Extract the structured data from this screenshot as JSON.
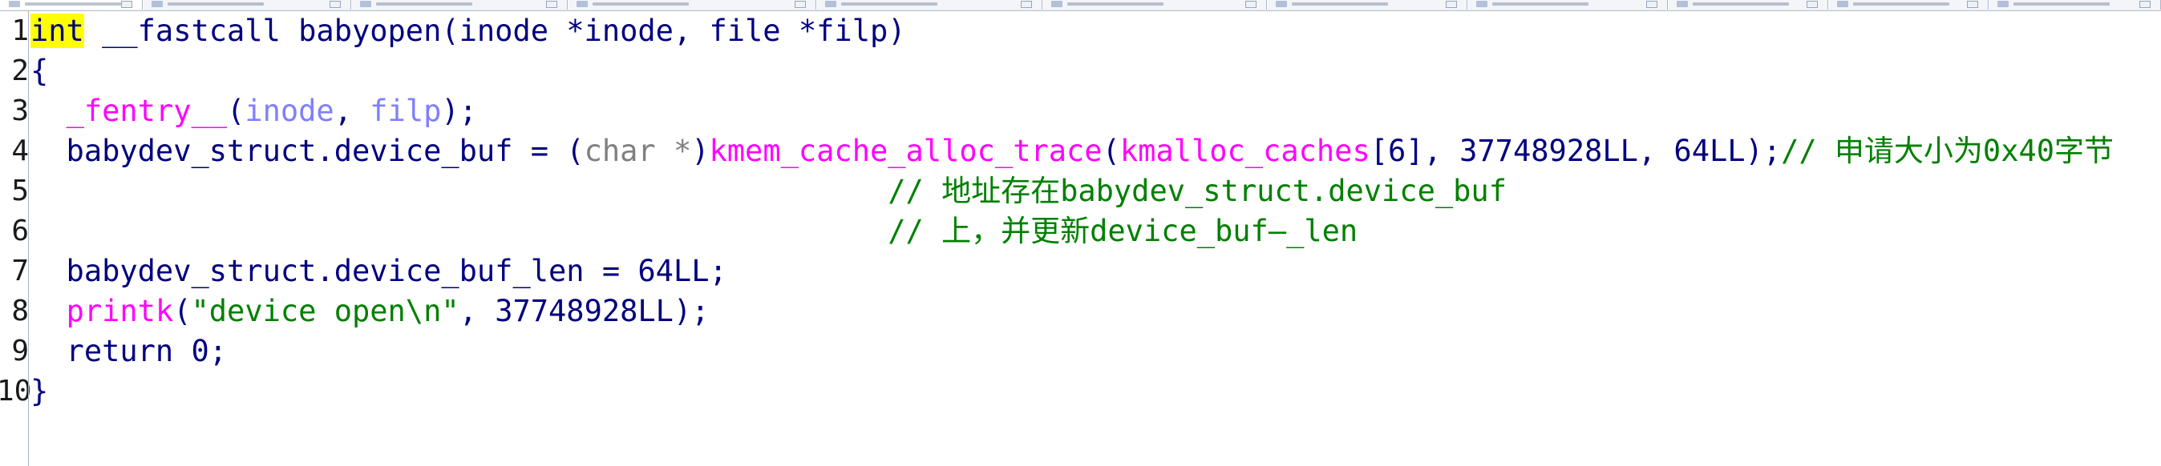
{
  "code_lines": [
    [
      {
        "t": "int",
        "c": "kw"
      },
      {
        "t": " __fastcall babyopen(inode *inode, file *filp)",
        "c": "id"
      }
    ],
    [
      {
        "t": "{",
        "c": "id"
      }
    ],
    [
      {
        "t": "  ",
        "c": "id"
      },
      {
        "t": "_fentry__",
        "c": "fn"
      },
      {
        "t": "(",
        "c": "id"
      },
      {
        "t": "inode",
        "c": "pm"
      },
      {
        "t": ", ",
        "c": "id"
      },
      {
        "t": "filp",
        "c": "pm"
      },
      {
        "t": ");",
        "c": "id"
      }
    ],
    [
      {
        "t": "  babydev_struct.device_buf = (",
        "c": "id"
      },
      {
        "t": "char *",
        "c": "ty"
      },
      {
        "t": ")",
        "c": "id"
      },
      {
        "t": "kmem_cache_alloc_trace",
        "c": "fn"
      },
      {
        "t": "(",
        "c": "id"
      },
      {
        "t": "kmalloc_caches",
        "c": "fn"
      },
      {
        "t": "[6], 37748928LL, 64LL);",
        "c": "id"
      },
      {
        "t": "// 申请大小为0x40字节",
        "c": "cm"
      }
    ],
    [
      {
        "t": "                                                // 地址存在babydev_struct.device_buf",
        "c": "cm"
      }
    ],
    [
      {
        "t": "                                                // 上，并更新device_buf—_len",
        "c": "cm"
      }
    ],
    [
      {
        "t": "  babydev_struct.device_buf_len = 64LL;",
        "c": "id"
      }
    ],
    [
      {
        "t": "  ",
        "c": "id"
      },
      {
        "t": "printk",
        "c": "fn"
      },
      {
        "t": "(",
        "c": "id"
      },
      {
        "t": "\"device open\\n\"",
        "c": "str"
      },
      {
        "t": ", 37748928LL);",
        "c": "id"
      }
    ],
    [
      {
        "t": "  return 0;",
        "c": "id"
      }
    ],
    [
      {
        "t": "}",
        "c": "id"
      }
    ]
  ],
  "line_numbers": [
    "1",
    "2",
    "3",
    "4",
    "5",
    "6",
    "7",
    "8",
    "9",
    "10"
  ]
}
